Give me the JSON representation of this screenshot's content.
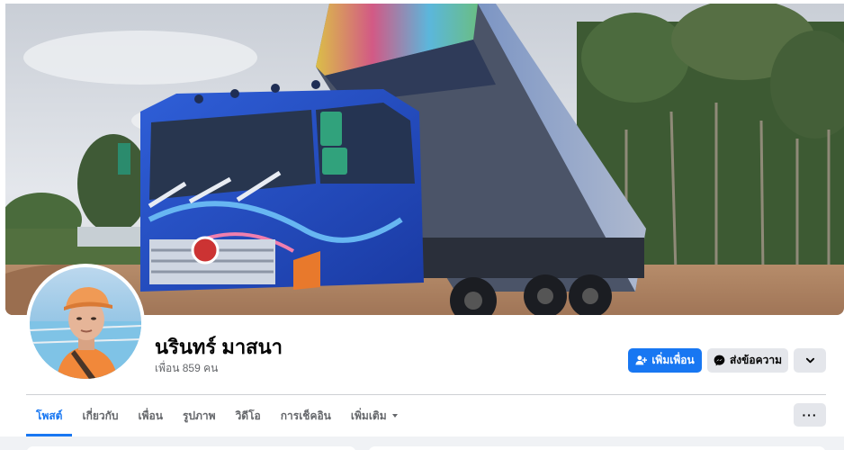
{
  "profile": {
    "name": "นรินทร์ มาสนา",
    "friends_count": "เพื่อน 859 คน"
  },
  "actions": {
    "add_friend": "เพิ่มเพื่อน",
    "message": "ส่งข้อความ"
  },
  "tabs": [
    {
      "label": "โพสต์",
      "active": true
    },
    {
      "label": "เกี่ยวกับ",
      "active": false
    },
    {
      "label": "เพื่อน",
      "active": false
    },
    {
      "label": "รูปภาพ",
      "active": false
    },
    {
      "label": "วิดีโอ",
      "active": false
    },
    {
      "label": "การเช็คอิน",
      "active": false
    },
    {
      "label": "เพิ่มเติม",
      "active": false
    }
  ],
  "icons": {
    "add_friend": "person-plus-icon",
    "message": "messenger-icon",
    "dropdown": "chevron-down-icon",
    "more": "ellipsis-icon",
    "tab_more_caret": "caret-down-icon"
  },
  "colors": {
    "primary": "#1877f2",
    "secondary_button": "#e4e6eb",
    "text_primary": "#050505",
    "text_secondary": "#65676b",
    "background": "#f0f2f5"
  }
}
